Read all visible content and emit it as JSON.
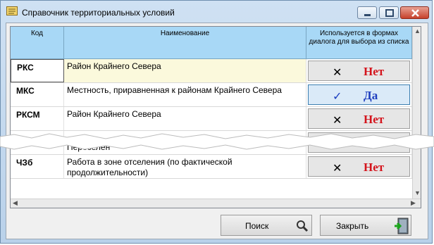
{
  "window": {
    "title": "Справочник территориальных условий"
  },
  "table": {
    "columns": [
      "Код",
      "Наименование",
      "Используется в формах диалога для выбора из списка"
    ],
    "rows": [
      {
        "code": "РКС",
        "name": "Район Крайнего Севера",
        "flag_label": "Нет",
        "flag_icon": "cross-icon",
        "selected": true
      },
      {
        "code": "МКС",
        "name": "Местность, приравненная к районам Крайнего Севера",
        "flag_label": "Да",
        "flag_icon": "check-icon"
      },
      {
        "code": "РКСМ",
        "name": "Район Крайнего Севера",
        "flag_label": "Нет",
        "flag_icon": "cross-icon"
      },
      {
        "code": "",
        "name": "Переселен",
        "flag_label": "",
        "flag_icon": ""
      },
      {
        "code": "ЧЗб",
        "name": "Работа в зоне отселения (по фактической продолжительности)",
        "flag_label": "Нет",
        "flag_icon": "cross-icon"
      }
    ]
  },
  "buttons": {
    "search": "Поиск",
    "close": "Закрыть"
  },
  "colors": {
    "header_bg": "#a8d8f6",
    "yes_text": "#1f3fbf",
    "no_text": "#d4141c",
    "selected_row_bg": "#fbf9dc"
  }
}
